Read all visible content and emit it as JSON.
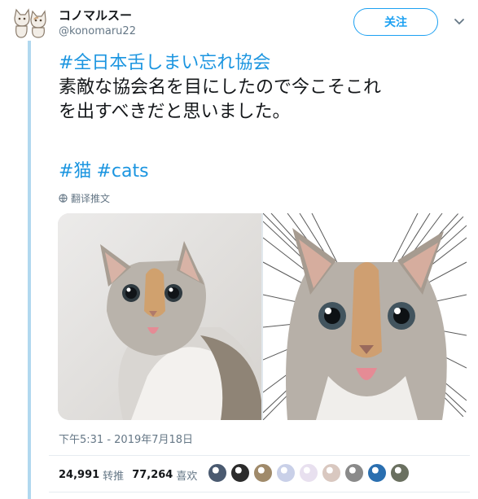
{
  "author": {
    "name": "コノマルスー",
    "handle": "@konomaru22"
  },
  "follow_label": "关注",
  "tweet": {
    "hashtag_line": "#全日本舌しまい忘れ協会",
    "body_line1": "素敵な協会名を目にしたので今こそこれ",
    "body_line2": "を出すべきだと思いました。",
    "tags": [
      "#猫",
      "#cats"
    ]
  },
  "translate_label": "翻译推文",
  "timestamp": "下午5:31 - 2019年7月18日",
  "stats": {
    "retweets": "24,991",
    "retweets_label": "转推",
    "likes": "77,264",
    "likes_label": "喜欢"
  },
  "liker_colors": [
    "#4a5a70",
    "#2b2b2b",
    "#a08a6a",
    "#c9d0e8",
    "#e8e0ef",
    "#d9c8c0",
    "#8a8a8a",
    "#2a6fb0",
    "#6a7060"
  ],
  "colors": {
    "accent": "#1da1f2",
    "thread_line": "#b1d8ef",
    "muted": "#657786"
  }
}
